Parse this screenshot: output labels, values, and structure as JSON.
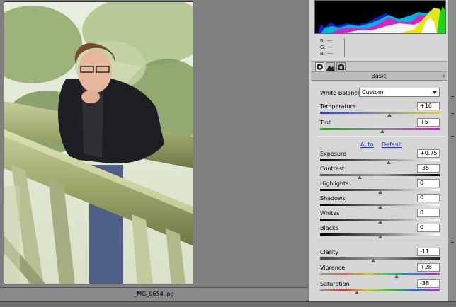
{
  "image": {
    "filename": "_MG_0654.jpg"
  },
  "readout": {
    "r_label": "R:",
    "r_value": "---",
    "g_label": "G:",
    "g_value": "---",
    "b_label": "B:",
    "b_value": "---"
  },
  "tabs": [
    {
      "icon": "aperture-icon",
      "active": true
    },
    {
      "icon": "mountain-tone-curve-icon",
      "active": false
    },
    {
      "icon": "camera-icon",
      "active": false
    }
  ],
  "section": {
    "title": "Basic",
    "menu_glyph": "≡"
  },
  "white_balance": {
    "label": "White Balance:",
    "value": "Custom"
  },
  "sliders": {
    "temperature": {
      "label": "Temperature",
      "value": "+16",
      "position": 0.58
    },
    "tint": {
      "label": "Tint",
      "value": "+5",
      "position": 0.52
    },
    "exposure": {
      "label": "Exposure",
      "value": "+0.75",
      "position": 0.575
    },
    "contrast": {
      "label": "Contrast",
      "value": "-35",
      "position": 0.33
    },
    "highlights": {
      "label": "Highlights",
      "value": "0",
      "position": 0.5
    },
    "shadows": {
      "label": "Shadows",
      "value": "0",
      "position": 0.5
    },
    "whites": {
      "label": "Whites",
      "value": "0",
      "position": 0.5
    },
    "blacks": {
      "label": "Blacks",
      "value": "0",
      "position": 0.5
    },
    "clarity": {
      "label": "Clarity",
      "value": "-11",
      "position": 0.445
    },
    "vibrance": {
      "label": "Vibrance",
      "value": "+28",
      "position": 0.64
    },
    "saturation": {
      "label": "Saturation",
      "value": "-38",
      "position": 0.31
    }
  },
  "links": {
    "auto": "Auto",
    "default": "Default"
  },
  "colors": {
    "panel_bg": "#d6d6d6",
    "canvas_bg": "#808080",
    "link_blue": "#1b35c9"
  }
}
